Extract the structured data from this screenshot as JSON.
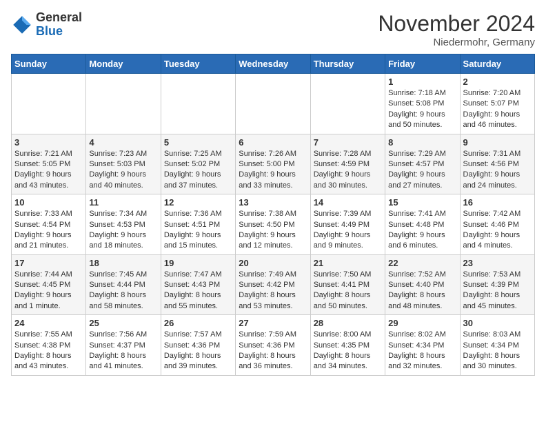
{
  "header": {
    "logo_general": "General",
    "logo_blue": "Blue",
    "month": "November 2024",
    "location": "Niedermohr, Germany"
  },
  "days_of_week": [
    "Sunday",
    "Monday",
    "Tuesday",
    "Wednesday",
    "Thursday",
    "Friday",
    "Saturday"
  ],
  "weeks": [
    {
      "cells": [
        {
          "day": "",
          "info": ""
        },
        {
          "day": "",
          "info": ""
        },
        {
          "day": "",
          "info": ""
        },
        {
          "day": "",
          "info": ""
        },
        {
          "day": "",
          "info": ""
        },
        {
          "day": "1",
          "info": "Sunrise: 7:18 AM\nSunset: 5:08 PM\nDaylight: 9 hours and 50 minutes."
        },
        {
          "day": "2",
          "info": "Sunrise: 7:20 AM\nSunset: 5:07 PM\nDaylight: 9 hours and 46 minutes."
        }
      ]
    },
    {
      "cells": [
        {
          "day": "3",
          "info": "Sunrise: 7:21 AM\nSunset: 5:05 PM\nDaylight: 9 hours and 43 minutes."
        },
        {
          "day": "4",
          "info": "Sunrise: 7:23 AM\nSunset: 5:03 PM\nDaylight: 9 hours and 40 minutes."
        },
        {
          "day": "5",
          "info": "Sunrise: 7:25 AM\nSunset: 5:02 PM\nDaylight: 9 hours and 37 minutes."
        },
        {
          "day": "6",
          "info": "Sunrise: 7:26 AM\nSunset: 5:00 PM\nDaylight: 9 hours and 33 minutes."
        },
        {
          "day": "7",
          "info": "Sunrise: 7:28 AM\nSunset: 4:59 PM\nDaylight: 9 hours and 30 minutes."
        },
        {
          "day": "8",
          "info": "Sunrise: 7:29 AM\nSunset: 4:57 PM\nDaylight: 9 hours and 27 minutes."
        },
        {
          "day": "9",
          "info": "Sunrise: 7:31 AM\nSunset: 4:56 PM\nDaylight: 9 hours and 24 minutes."
        }
      ]
    },
    {
      "cells": [
        {
          "day": "10",
          "info": "Sunrise: 7:33 AM\nSunset: 4:54 PM\nDaylight: 9 hours and 21 minutes."
        },
        {
          "day": "11",
          "info": "Sunrise: 7:34 AM\nSunset: 4:53 PM\nDaylight: 9 hours and 18 minutes."
        },
        {
          "day": "12",
          "info": "Sunrise: 7:36 AM\nSunset: 4:51 PM\nDaylight: 9 hours and 15 minutes."
        },
        {
          "day": "13",
          "info": "Sunrise: 7:38 AM\nSunset: 4:50 PM\nDaylight: 9 hours and 12 minutes."
        },
        {
          "day": "14",
          "info": "Sunrise: 7:39 AM\nSunset: 4:49 PM\nDaylight: 9 hours and 9 minutes."
        },
        {
          "day": "15",
          "info": "Sunrise: 7:41 AM\nSunset: 4:48 PM\nDaylight: 9 hours and 6 minutes."
        },
        {
          "day": "16",
          "info": "Sunrise: 7:42 AM\nSunset: 4:46 PM\nDaylight: 9 hours and 4 minutes."
        }
      ]
    },
    {
      "cells": [
        {
          "day": "17",
          "info": "Sunrise: 7:44 AM\nSunset: 4:45 PM\nDaylight: 9 hours and 1 minute."
        },
        {
          "day": "18",
          "info": "Sunrise: 7:45 AM\nSunset: 4:44 PM\nDaylight: 8 hours and 58 minutes."
        },
        {
          "day": "19",
          "info": "Sunrise: 7:47 AM\nSunset: 4:43 PM\nDaylight: 8 hours and 55 minutes."
        },
        {
          "day": "20",
          "info": "Sunrise: 7:49 AM\nSunset: 4:42 PM\nDaylight: 8 hours and 53 minutes."
        },
        {
          "day": "21",
          "info": "Sunrise: 7:50 AM\nSunset: 4:41 PM\nDaylight: 8 hours and 50 minutes."
        },
        {
          "day": "22",
          "info": "Sunrise: 7:52 AM\nSunset: 4:40 PM\nDaylight: 8 hours and 48 minutes."
        },
        {
          "day": "23",
          "info": "Sunrise: 7:53 AM\nSunset: 4:39 PM\nDaylight: 8 hours and 45 minutes."
        }
      ]
    },
    {
      "cells": [
        {
          "day": "24",
          "info": "Sunrise: 7:55 AM\nSunset: 4:38 PM\nDaylight: 8 hours and 43 minutes."
        },
        {
          "day": "25",
          "info": "Sunrise: 7:56 AM\nSunset: 4:37 PM\nDaylight: 8 hours and 41 minutes."
        },
        {
          "day": "26",
          "info": "Sunrise: 7:57 AM\nSunset: 4:36 PM\nDaylight: 8 hours and 39 minutes."
        },
        {
          "day": "27",
          "info": "Sunrise: 7:59 AM\nSunset: 4:36 PM\nDaylight: 8 hours and 36 minutes."
        },
        {
          "day": "28",
          "info": "Sunrise: 8:00 AM\nSunset: 4:35 PM\nDaylight: 8 hours and 34 minutes."
        },
        {
          "day": "29",
          "info": "Sunrise: 8:02 AM\nSunset: 4:34 PM\nDaylight: 8 hours and 32 minutes."
        },
        {
          "day": "30",
          "info": "Sunrise: 8:03 AM\nSunset: 4:34 PM\nDaylight: 8 hours and 30 minutes."
        }
      ]
    }
  ]
}
